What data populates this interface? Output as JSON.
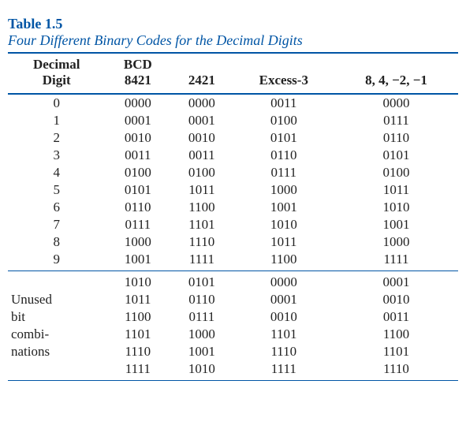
{
  "table_label": "Table 1.5",
  "table_title": "Four Different Binary Codes for the Decimal Digits",
  "headers": {
    "col1_line1": "Decimal",
    "col1_line2": "Digit",
    "col2_line1": "BCD",
    "col2_line2": "8421",
    "col3": "2421",
    "col4": "Excess-3",
    "col5": "8, 4, −2, −1"
  },
  "digits": [
    {
      "d": "0",
      "bcd": "0000",
      "c2421": "0000",
      "ex3": "0011",
      "c84m2m1": "0000"
    },
    {
      "d": "1",
      "bcd": "0001",
      "c2421": "0001",
      "ex3": "0100",
      "c84m2m1": "0111"
    },
    {
      "d": "2",
      "bcd": "0010",
      "c2421": "0010",
      "ex3": "0101",
      "c84m2m1": "0110"
    },
    {
      "d": "3",
      "bcd": "0011",
      "c2421": "0011",
      "ex3": "0110",
      "c84m2m1": "0101"
    },
    {
      "d": "4",
      "bcd": "0100",
      "c2421": "0100",
      "ex3": "0111",
      "c84m2m1": "0100"
    },
    {
      "d": "5",
      "bcd": "0101",
      "c2421": "1011",
      "ex3": "1000",
      "c84m2m1": "1011"
    },
    {
      "d": "6",
      "bcd": "0110",
      "c2421": "1100",
      "ex3": "1001",
      "c84m2m1": "1010"
    },
    {
      "d": "7",
      "bcd": "0111",
      "c2421": "1101",
      "ex3": "1010",
      "c84m2m1": "1001"
    },
    {
      "d": "8",
      "bcd": "1000",
      "c2421": "1110",
      "ex3": "1011",
      "c84m2m1": "1000"
    },
    {
      "d": "9",
      "bcd": "1001",
      "c2421": "1111",
      "ex3": "1100",
      "c84m2m1": "1111"
    }
  ],
  "unused_label_lines": [
    "",
    "Unused",
    "bit",
    "combi-",
    "nations",
    ""
  ],
  "unused": [
    {
      "bcd": "1010",
      "c2421": "0101",
      "ex3": "0000",
      "c84m2m1": "0001"
    },
    {
      "bcd": "1011",
      "c2421": "0110",
      "ex3": "0001",
      "c84m2m1": "0010"
    },
    {
      "bcd": "1100",
      "c2421": "0111",
      "ex3": "0010",
      "c84m2m1": "0011"
    },
    {
      "bcd": "1101",
      "c2421": "1000",
      "ex3": "1101",
      "c84m2m1": "1100"
    },
    {
      "bcd": "1110",
      "c2421": "1001",
      "ex3": "1110",
      "c84m2m1": "1101"
    },
    {
      "bcd": "1111",
      "c2421": "1010",
      "ex3": "1111",
      "c84m2m1": "1110"
    }
  ],
  "chart_data": {
    "type": "table",
    "title": "Four Different Binary Codes for the Decimal Digits",
    "columns": [
      "Decimal Digit",
      "BCD 8421",
      "2421",
      "Excess-3",
      "8,4,-2,-1"
    ],
    "rows": [
      [
        "0",
        "0000",
        "0000",
        "0011",
        "0000"
      ],
      [
        "1",
        "0001",
        "0001",
        "0100",
        "0111"
      ],
      [
        "2",
        "0010",
        "0010",
        "0101",
        "0110"
      ],
      [
        "3",
        "0011",
        "0011",
        "0110",
        "0101"
      ],
      [
        "4",
        "0100",
        "0100",
        "0111",
        "0100"
      ],
      [
        "5",
        "0101",
        "1011",
        "1000",
        "1011"
      ],
      [
        "6",
        "0110",
        "1100",
        "1001",
        "1010"
      ],
      [
        "7",
        "0111",
        "1101",
        "1010",
        "1001"
      ],
      [
        "8",
        "1000",
        "1110",
        "1011",
        "1000"
      ],
      [
        "9",
        "1001",
        "1111",
        "1100",
        "1111"
      ]
    ],
    "unused_rows": [
      [
        "1010",
        "0101",
        "0000",
        "0001"
      ],
      [
        "1011",
        "0110",
        "0001",
        "0010"
      ],
      [
        "1100",
        "0111",
        "0010",
        "0011"
      ],
      [
        "1101",
        "1000",
        "1101",
        "1100"
      ],
      [
        "1110",
        "1001",
        "1110",
        "1101"
      ],
      [
        "1111",
        "1010",
        "1111",
        "1110"
      ]
    ]
  }
}
